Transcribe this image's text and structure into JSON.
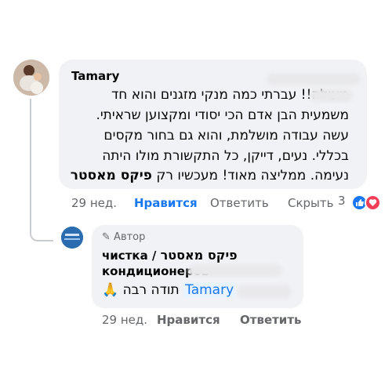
{
  "comment": {
    "author": "Tamary",
    "lines": [
      "מעולה!! עברתי כמה מנקי מזגנים והוא חד",
      "משמעית הבן אדם הכי יסודי ומקצוען שראיתי.",
      "עשה עבודה מושלמת, והוא גם בחור מקסים",
      "בכללי. נעים, דייקן, כל התקשורת מולו היתה",
      "נעימה. ממליצה מאוד! מעכשיו רק"
    ],
    "brand_mention": "פיקס מאסטר",
    "time": "29 нед.",
    "like": "Нравится",
    "reply": "Ответить",
    "hide": "Скрыть",
    "reaction_count": "3",
    "reaction_icons": [
      "like-icon",
      "love-icon"
    ],
    "colors": {
      "like": "#1877f2",
      "love": "#f33e58"
    }
  },
  "reply_comment": {
    "author_badge": "Автор",
    "page_name_brand": "פיקס מאסטר",
    "page_name_rest_1": "чистка /",
    "page_name_rest_2": "кондиционеров",
    "message_text": "תודה רבה",
    "mention": "Tamary",
    "emoji": "🙏",
    "time": "29 нед.",
    "like": "Нравится",
    "reply": "Ответить"
  }
}
